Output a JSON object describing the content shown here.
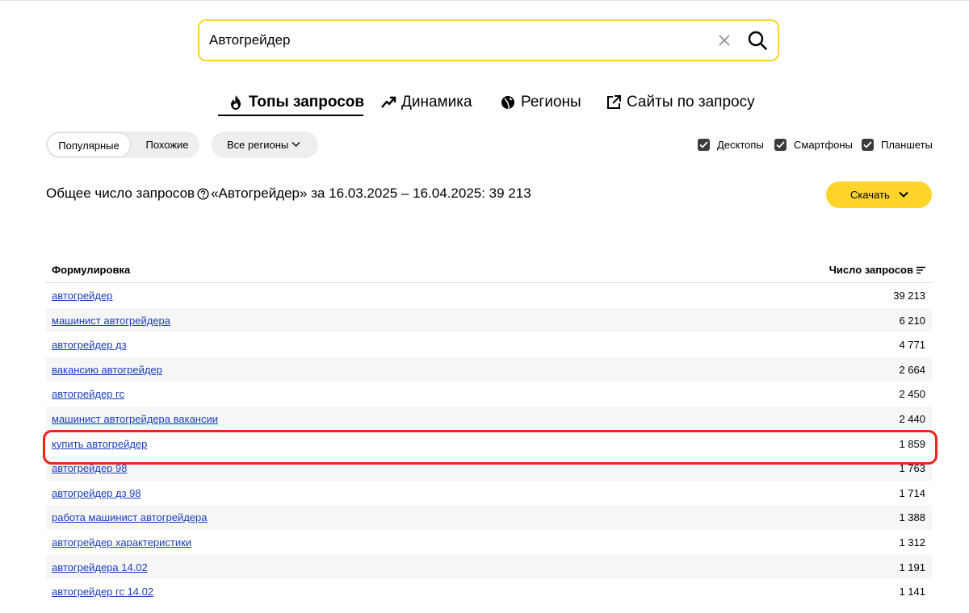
{
  "search": {
    "value": "Автогрейдер"
  },
  "tabs": [
    {
      "label": "Топы запросов",
      "icon": "fire-icon",
      "active": true
    },
    {
      "label": "Динамика",
      "icon": "trend-up-icon"
    },
    {
      "label": "Регионы",
      "icon": "globe-icon"
    },
    {
      "label": "Сайты по запросу",
      "icon": "external-link-icon"
    }
  ],
  "filters": {
    "mode": {
      "popular": "Популярные",
      "similar": "Похожие",
      "selected": "Популярные"
    },
    "region": "Все регионы",
    "devices": [
      {
        "label": "Десктопы",
        "checked": true
      },
      {
        "label": "Смартфоны",
        "checked": true
      },
      {
        "label": "Планшеты",
        "checked": true
      }
    ]
  },
  "summary": {
    "prefix": "Общее число запросов",
    "text": "«Автогрейдер» за 16.03.2025 – 16.04.2025: 39 213"
  },
  "download": {
    "label": "Скачать"
  },
  "table": {
    "headers": {
      "phrase": "Формулировка",
      "count": "Число запросов"
    },
    "rows": [
      {
        "phrase": "автогрейдер",
        "count": "39 213"
      },
      {
        "phrase": "машинист автогрейдера",
        "count": "6 210"
      },
      {
        "phrase": "автогрейдер дз",
        "count": "4 771"
      },
      {
        "phrase": "вакансию автогрейдер",
        "count": "2 664"
      },
      {
        "phrase": "автогрейдер гс",
        "count": "2 450"
      },
      {
        "phrase": "машинист автогрейдера вакансии",
        "count": "2 440"
      },
      {
        "phrase": "купить автогрейдер",
        "count": "1 859",
        "highlighted": true
      },
      {
        "phrase": "автогрейдер 98",
        "count": "1 763"
      },
      {
        "phrase": "автогрейдер дз 98",
        "count": "1 714"
      },
      {
        "phrase": "работа машинист автогрейдера",
        "count": "1 388"
      },
      {
        "phrase": "автогрейдер характеристики",
        "count": "1 312"
      },
      {
        "phrase": "автогрейдера 14.02",
        "count": "1 191"
      },
      {
        "phrase": "автогрейдер гс 14.02",
        "count": "1 141"
      }
    ]
  },
  "colors": {
    "accent": "#fed42b",
    "link": "#1a3dc1",
    "highlight": "#f2211b"
  }
}
